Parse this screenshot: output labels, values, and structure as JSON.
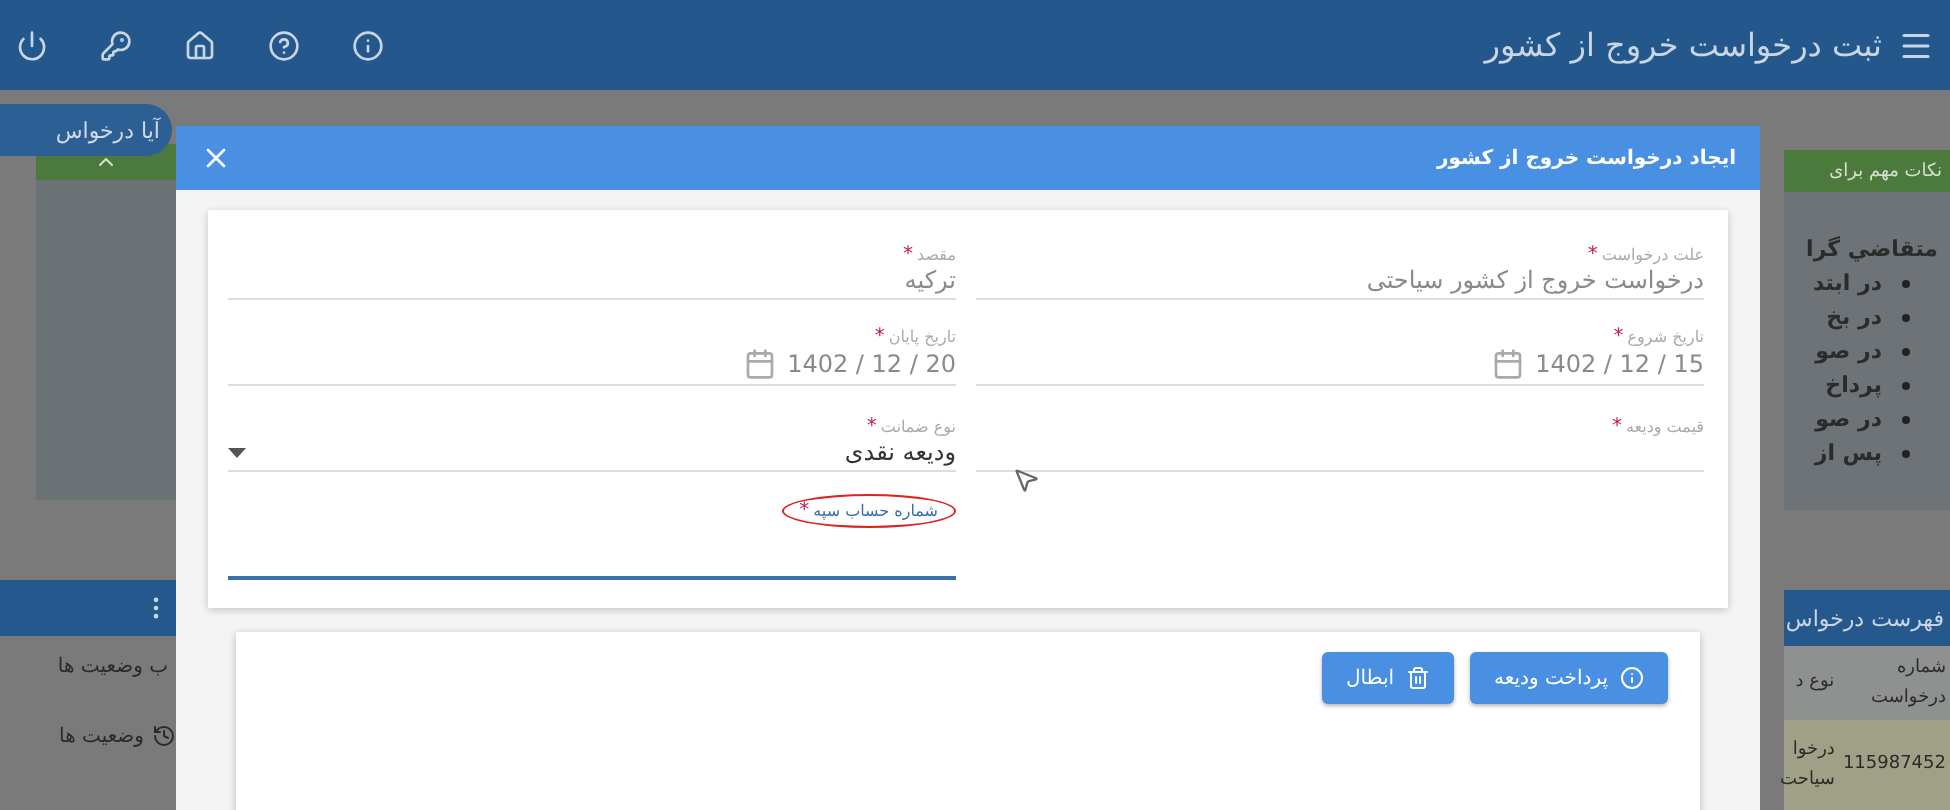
{
  "app_bar": {
    "title": "ثبت درخواست خروج از کشور"
  },
  "left_strip": {
    "pill": "آیا درخواس",
    "list_header": "ب وضعیت ها",
    "status_link": "وضعیت ها"
  },
  "right_strip": {
    "notes_bar": "نکات مهم برای",
    "notes_title": "متقاضي گرا",
    "notes": [
      "در ابتد",
      "در بخ",
      "در صو",
      "پرداخ",
      "در صو",
      "پس از"
    ],
    "list_bar": "فهرست درخواس",
    "columns": [
      "شماره درخواست",
      "نوع د"
    ],
    "row": [
      "115987452",
      "درخوا سیاحت"
    ]
  },
  "dialog": {
    "title": "ایجاد درخواست خروج از کشور",
    "fields": [
      {
        "kind": "text",
        "label": "علت درخواست",
        "mark": "*",
        "value": "درخواست خروج از کشور سیاحتی",
        "disabled": true,
        "focused": false,
        "circled": false
      },
      {
        "kind": "text",
        "label": "مقصد",
        "mark": "*",
        "value": "ترکیه",
        "disabled": true,
        "focused": false,
        "circled": false
      },
      {
        "kind": "date",
        "label": "تاریخ شروع",
        "mark": "*",
        "value": "1402 / 12 / 15",
        "disabled": true,
        "focused": false,
        "circled": false
      },
      {
        "kind": "date",
        "label": "تاریخ پایان",
        "mark": "*",
        "value": "1402 / 12 / 20",
        "disabled": true,
        "focused": false,
        "circled": false
      },
      {
        "kind": "text",
        "label": "قیمت ودیعه",
        "mark": "*",
        "focused": false,
        "circled": false
      },
      {
        "kind": "select",
        "label": "نوع ضمانت",
        "mark": "*",
        "value": "ودیعه نقدی",
        "disabled": false,
        "focused": false,
        "circled": false
      },
      {
        "kind": "empty"
      },
      {
        "kind": "text",
        "label": "شماره حساب سپه",
        "mark": "*",
        "focused": true,
        "circled": true
      }
    ],
    "buttons": [
      {
        "label": "پرداخت ودیعه"
      },
      {
        "label": "ابطال"
      }
    ]
  }
}
